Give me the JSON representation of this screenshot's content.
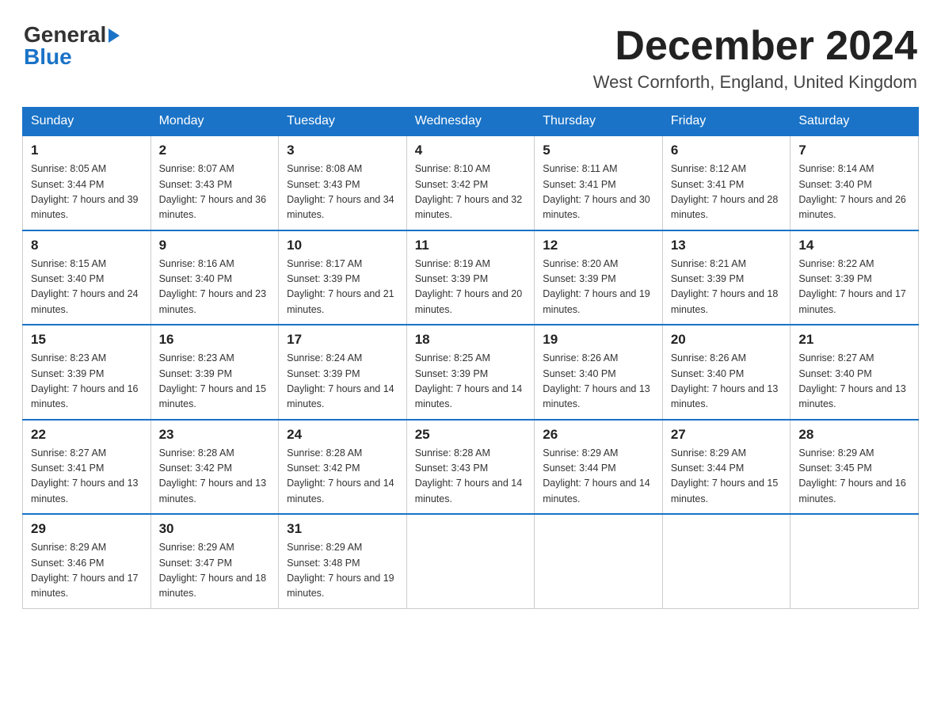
{
  "header": {
    "logo": {
      "general": "General",
      "blue": "Blue",
      "arrow": "▶"
    },
    "title": "December 2024",
    "location": "West Cornforth, England, United Kingdom"
  },
  "days_of_week": [
    "Sunday",
    "Monday",
    "Tuesday",
    "Wednesday",
    "Thursday",
    "Friday",
    "Saturday"
  ],
  "weeks": [
    [
      {
        "day": "1",
        "sunrise": "Sunrise: 8:05 AM",
        "sunset": "Sunset: 3:44 PM",
        "daylight": "Daylight: 7 hours and 39 minutes."
      },
      {
        "day": "2",
        "sunrise": "Sunrise: 8:07 AM",
        "sunset": "Sunset: 3:43 PM",
        "daylight": "Daylight: 7 hours and 36 minutes."
      },
      {
        "day": "3",
        "sunrise": "Sunrise: 8:08 AM",
        "sunset": "Sunset: 3:43 PM",
        "daylight": "Daylight: 7 hours and 34 minutes."
      },
      {
        "day": "4",
        "sunrise": "Sunrise: 8:10 AM",
        "sunset": "Sunset: 3:42 PM",
        "daylight": "Daylight: 7 hours and 32 minutes."
      },
      {
        "day": "5",
        "sunrise": "Sunrise: 8:11 AM",
        "sunset": "Sunset: 3:41 PM",
        "daylight": "Daylight: 7 hours and 30 minutes."
      },
      {
        "day": "6",
        "sunrise": "Sunrise: 8:12 AM",
        "sunset": "Sunset: 3:41 PM",
        "daylight": "Daylight: 7 hours and 28 minutes."
      },
      {
        "day": "7",
        "sunrise": "Sunrise: 8:14 AM",
        "sunset": "Sunset: 3:40 PM",
        "daylight": "Daylight: 7 hours and 26 minutes."
      }
    ],
    [
      {
        "day": "8",
        "sunrise": "Sunrise: 8:15 AM",
        "sunset": "Sunset: 3:40 PM",
        "daylight": "Daylight: 7 hours and 24 minutes."
      },
      {
        "day": "9",
        "sunrise": "Sunrise: 8:16 AM",
        "sunset": "Sunset: 3:40 PM",
        "daylight": "Daylight: 7 hours and 23 minutes."
      },
      {
        "day": "10",
        "sunrise": "Sunrise: 8:17 AM",
        "sunset": "Sunset: 3:39 PM",
        "daylight": "Daylight: 7 hours and 21 minutes."
      },
      {
        "day": "11",
        "sunrise": "Sunrise: 8:19 AM",
        "sunset": "Sunset: 3:39 PM",
        "daylight": "Daylight: 7 hours and 20 minutes."
      },
      {
        "day": "12",
        "sunrise": "Sunrise: 8:20 AM",
        "sunset": "Sunset: 3:39 PM",
        "daylight": "Daylight: 7 hours and 19 minutes."
      },
      {
        "day": "13",
        "sunrise": "Sunrise: 8:21 AM",
        "sunset": "Sunset: 3:39 PM",
        "daylight": "Daylight: 7 hours and 18 minutes."
      },
      {
        "day": "14",
        "sunrise": "Sunrise: 8:22 AM",
        "sunset": "Sunset: 3:39 PM",
        "daylight": "Daylight: 7 hours and 17 minutes."
      }
    ],
    [
      {
        "day": "15",
        "sunrise": "Sunrise: 8:23 AM",
        "sunset": "Sunset: 3:39 PM",
        "daylight": "Daylight: 7 hours and 16 minutes."
      },
      {
        "day": "16",
        "sunrise": "Sunrise: 8:23 AM",
        "sunset": "Sunset: 3:39 PM",
        "daylight": "Daylight: 7 hours and 15 minutes."
      },
      {
        "day": "17",
        "sunrise": "Sunrise: 8:24 AM",
        "sunset": "Sunset: 3:39 PM",
        "daylight": "Daylight: 7 hours and 14 minutes."
      },
      {
        "day": "18",
        "sunrise": "Sunrise: 8:25 AM",
        "sunset": "Sunset: 3:39 PM",
        "daylight": "Daylight: 7 hours and 14 minutes."
      },
      {
        "day": "19",
        "sunrise": "Sunrise: 8:26 AM",
        "sunset": "Sunset: 3:40 PM",
        "daylight": "Daylight: 7 hours and 13 minutes."
      },
      {
        "day": "20",
        "sunrise": "Sunrise: 8:26 AM",
        "sunset": "Sunset: 3:40 PM",
        "daylight": "Daylight: 7 hours and 13 minutes."
      },
      {
        "day": "21",
        "sunrise": "Sunrise: 8:27 AM",
        "sunset": "Sunset: 3:40 PM",
        "daylight": "Daylight: 7 hours and 13 minutes."
      }
    ],
    [
      {
        "day": "22",
        "sunrise": "Sunrise: 8:27 AM",
        "sunset": "Sunset: 3:41 PM",
        "daylight": "Daylight: 7 hours and 13 minutes."
      },
      {
        "day": "23",
        "sunrise": "Sunrise: 8:28 AM",
        "sunset": "Sunset: 3:42 PM",
        "daylight": "Daylight: 7 hours and 13 minutes."
      },
      {
        "day": "24",
        "sunrise": "Sunrise: 8:28 AM",
        "sunset": "Sunset: 3:42 PM",
        "daylight": "Daylight: 7 hours and 14 minutes."
      },
      {
        "day": "25",
        "sunrise": "Sunrise: 8:28 AM",
        "sunset": "Sunset: 3:43 PM",
        "daylight": "Daylight: 7 hours and 14 minutes."
      },
      {
        "day": "26",
        "sunrise": "Sunrise: 8:29 AM",
        "sunset": "Sunset: 3:44 PM",
        "daylight": "Daylight: 7 hours and 14 minutes."
      },
      {
        "day": "27",
        "sunrise": "Sunrise: 8:29 AM",
        "sunset": "Sunset: 3:44 PM",
        "daylight": "Daylight: 7 hours and 15 minutes."
      },
      {
        "day": "28",
        "sunrise": "Sunrise: 8:29 AM",
        "sunset": "Sunset: 3:45 PM",
        "daylight": "Daylight: 7 hours and 16 minutes."
      }
    ],
    [
      {
        "day": "29",
        "sunrise": "Sunrise: 8:29 AM",
        "sunset": "Sunset: 3:46 PM",
        "daylight": "Daylight: 7 hours and 17 minutes."
      },
      {
        "day": "30",
        "sunrise": "Sunrise: 8:29 AM",
        "sunset": "Sunset: 3:47 PM",
        "daylight": "Daylight: 7 hours and 18 minutes."
      },
      {
        "day": "31",
        "sunrise": "Sunrise: 8:29 AM",
        "sunset": "Sunset: 3:48 PM",
        "daylight": "Daylight: 7 hours and 19 minutes."
      },
      null,
      null,
      null,
      null
    ]
  ]
}
